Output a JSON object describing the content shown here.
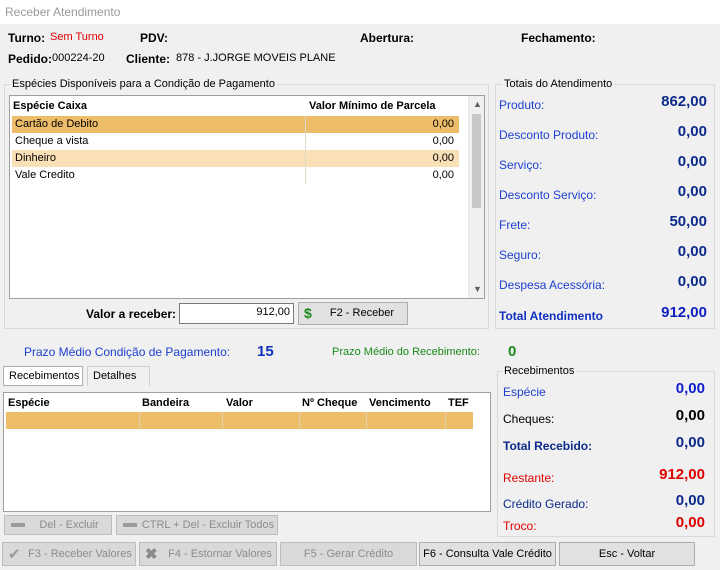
{
  "window": {
    "title": "Receber Atendimento"
  },
  "header": {
    "turno_label": "Turno:",
    "turno_value": "Sem Turno",
    "pdv_label": "PDV:",
    "abertura_label": "Abertura:",
    "fechamento_label": "Fechamento:",
    "pedido_label": "Pedido:",
    "pedido_value": "000224-20",
    "cliente_label": "Cliente:",
    "cliente_value": "878 - J.JORGE MOVEIS PLANE"
  },
  "especies": {
    "group_title": "Espécies Disponíveis para a Condição de Pagamento",
    "columns": [
      "Espécie Caixa",
      "Valor Mínimo de Parcela"
    ],
    "rows": [
      {
        "name": "Cartão de Debito",
        "value": "0,00"
      },
      {
        "name": "Cheque a vista",
        "value": "0,00"
      },
      {
        "name": "Dinheiro",
        "value": "0,00"
      },
      {
        "name": "Vale Credito",
        "value": "0,00"
      }
    ],
    "valor_label": "Valor a receber:",
    "valor_input": "912,00",
    "receber_button": "F2 - Receber",
    "receber_icon_glyph": "$"
  },
  "totais": {
    "group_title": "Totais do Atendimento",
    "items": [
      {
        "label": "Produto:",
        "value": "862,00"
      },
      {
        "label": "Desconto Produto:",
        "value": "0,00"
      },
      {
        "label": "Serviço:",
        "value": "0,00"
      },
      {
        "label": "Desconto Serviço:",
        "value": "0,00"
      },
      {
        "label": "Frete:",
        "value": "50,00"
      },
      {
        "label": "Seguro:",
        "value": "0,00"
      },
      {
        "label": "Despesa Acessória:",
        "value": "0,00"
      }
    ],
    "total_label": "Total Atendimento",
    "total_value": "912,00"
  },
  "prazo": {
    "medio_label": "Prazo Médio Condição de Pagamento:",
    "medio_value": "15",
    "recebimento_label": "Prazo Médio do Recebimento:",
    "recebimento_value": "0"
  },
  "tabs": [
    {
      "label": "Recebimentos"
    },
    {
      "label": "Detalhes"
    }
  ],
  "recebimentos_grid": {
    "columns": [
      "Espécie",
      "Bandeira",
      "Valor",
      "Nº Cheque",
      "Vencimento",
      "TEF"
    ]
  },
  "recebimentos_totais": {
    "group_title": "Recebimentos",
    "especie_label": "Espécie",
    "especie_value": "0,00",
    "cheques_label": "Cheques:",
    "cheques_value": "0,00",
    "total_label": "Total Recebido:",
    "total_value": "0,00",
    "restante_label": "Restante:",
    "restante_value": "912,00",
    "credito_label": "Crédito Gerado:",
    "credito_value": "0,00",
    "troco_label": "Troco:",
    "troco_value": "0,00"
  },
  "actions": {
    "del_excluir": "Del - Excluir",
    "ctrl_del": "CTRL + Del - Excluir Todos",
    "f3": "F3 - Receber Valores",
    "f4": "F4 - Estornar Valores",
    "f5": "F5 - Gerar Crédito",
    "f6": "F6 - Consulta Vale Crédito",
    "esc": "Esc - Voltar"
  },
  "colors": {
    "accent_blue": "#1f40d0",
    "selected_row": "#eebd6a",
    "alt_row": "#f9e0b7",
    "negative_red": "#e00000",
    "green": "#1a8a1a"
  }
}
